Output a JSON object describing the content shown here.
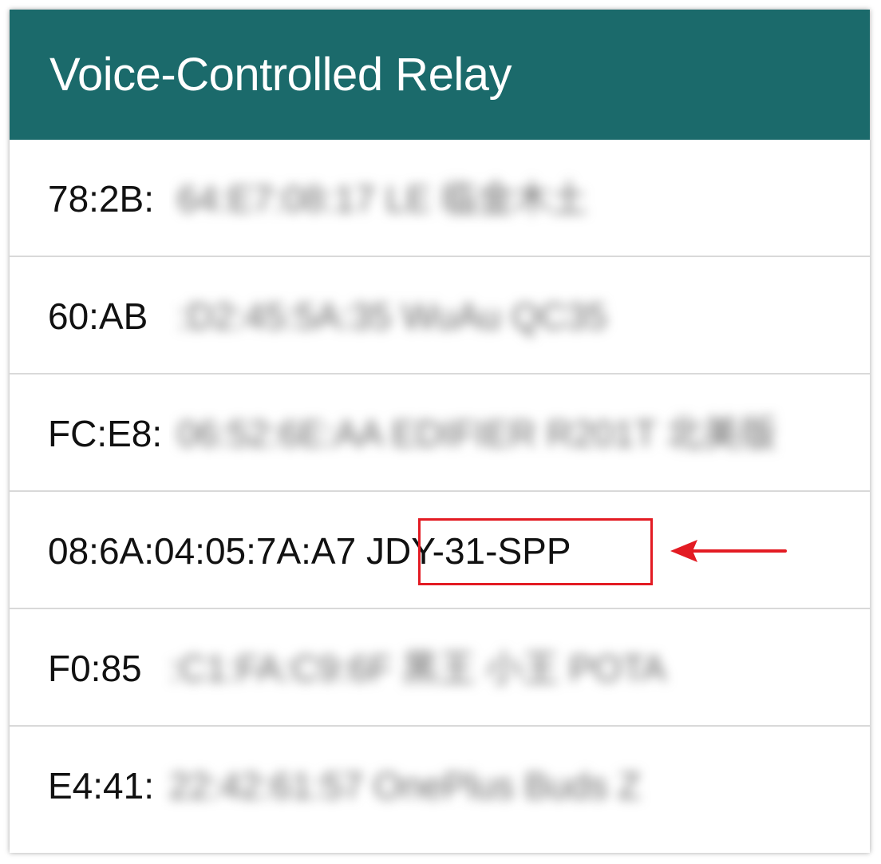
{
  "app": {
    "title": "Voice-Controlled Relay",
    "appbar_color": "#1b6a6b"
  },
  "devices": [
    {
      "visible": "78:2B:",
      "obscured": "64:E7:08:17 LE 临金木土"
    },
    {
      "visible": "60:AB",
      "obscured": ":D2:45:5A:35 WuAu QC35"
    },
    {
      "visible": "FC:E8:",
      "obscured": "06:52:6E:AA EDIFIER R201T 北美版"
    },
    {
      "visible": "08:6A:04:05:7A:A7 JDY-31-SPP",
      "obscured": ""
    },
    {
      "visible": "F0:85",
      "obscured": ":C1:FA:C9:6F 黑王 小王 POTA"
    },
    {
      "visible": "E4:41:",
      "obscured": "22:42:61:57 OnePlus Buds Z"
    }
  ],
  "annotation": {
    "highlight_color": "#e31b23",
    "arrow_icon": "left-arrow-icon"
  }
}
